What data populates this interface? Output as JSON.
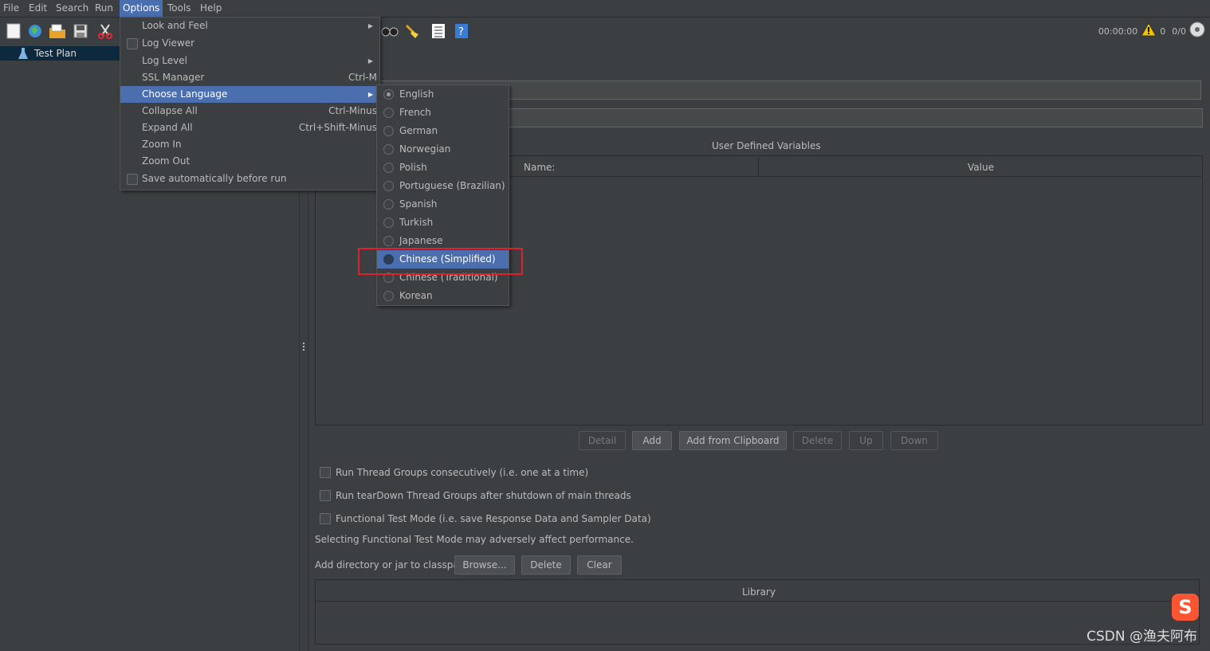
{
  "menubar": {
    "items": [
      "File",
      "Edit",
      "Search",
      "Run",
      "Options",
      "Tools",
      "Help"
    ],
    "active": "Options"
  },
  "status": {
    "timer": "00:00:00",
    "warnings": "0",
    "threads": "0/0"
  },
  "tree": {
    "root": "Test Plan"
  },
  "options_menu": {
    "items": [
      {
        "label": "Look and Feel",
        "accel": "",
        "submenu": true
      },
      {
        "label": "Log Viewer",
        "accel": "",
        "checkbox": true
      },
      {
        "label": "Log Level",
        "accel": "",
        "submenu": true
      },
      {
        "label": "SSL Manager",
        "accel": "Ctrl-M"
      },
      {
        "label": "Choose Language",
        "accel": "",
        "submenu": true,
        "selected": true
      },
      {
        "label": "Collapse All",
        "accel": "Ctrl-Minus"
      },
      {
        "label": "Expand All",
        "accel": "Ctrl+Shift-Minus"
      },
      {
        "label": "Zoom In",
        "accel": ""
      },
      {
        "label": "Zoom Out",
        "accel": ""
      },
      {
        "label": "Save automatically before run",
        "accel": "",
        "checkbox": true
      }
    ]
  },
  "language_menu": {
    "items": [
      "English",
      "French",
      "German",
      "Norwegian",
      "Polish",
      "Portuguese (Brazilian)",
      "Spanish",
      "Turkish",
      "Japanese",
      "Chinese (Simplified)",
      "Chinese (Traditional)",
      "Korean"
    ],
    "checked": "English",
    "highlighted": "Chinese (Simplified)"
  },
  "udv": {
    "title": "User Defined Variables",
    "col_name": "Name:",
    "col_value": "Value"
  },
  "udv_buttons": {
    "detail": "Detail",
    "add": "Add",
    "add_clipboard": "Add from Clipboard",
    "delete": "Delete",
    "up": "Up",
    "down": "Down"
  },
  "options": {
    "consecutive": "Run Thread Groups consecutively (i.e. one at a time)",
    "teardown": "Run tearDown Thread Groups after shutdown of main threads",
    "functional": "Functional Test Mode (i.e. save Response Data and Sampler Data)",
    "functional_note": "Selecting Functional Test Mode may adversely affect performance."
  },
  "classpath": {
    "label": "Add directory or jar to classpath",
    "browse": "Browse...",
    "delete": "Delete",
    "clear": "Clear",
    "library_header": "Library"
  },
  "watermark": "CSDN @渔夫阿布",
  "colors": {
    "accent": "#4b6eaf",
    "background": "#3c3f41",
    "highlight_box": "#e0202a"
  }
}
